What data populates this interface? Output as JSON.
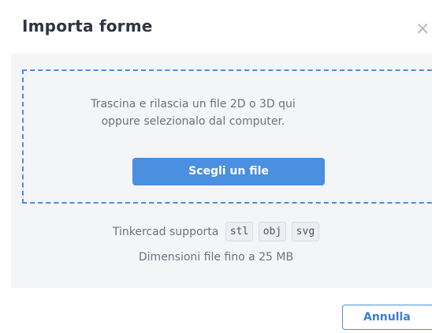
{
  "dialog": {
    "title": "Importa forme",
    "close_icon": "close-icon",
    "close_glyph": "×"
  },
  "dropzone": {
    "line1": "Trascina e rilascia un file 2D o 3D qui",
    "line2": "oppure selezionalo dal computer.",
    "choose_button": "Scegli un file"
  },
  "support": {
    "label": "Tinkercad supporta",
    "formats": [
      "stl",
      "obj",
      "svg"
    ],
    "size_limit": "Dimensioni file fino a 25 MB"
  },
  "footer": {
    "cancel_button": "Annulla"
  },
  "colors": {
    "accent": "#4a8fe0",
    "body_bg": "#f4f5f7",
    "text_muted": "#6b7280"
  }
}
